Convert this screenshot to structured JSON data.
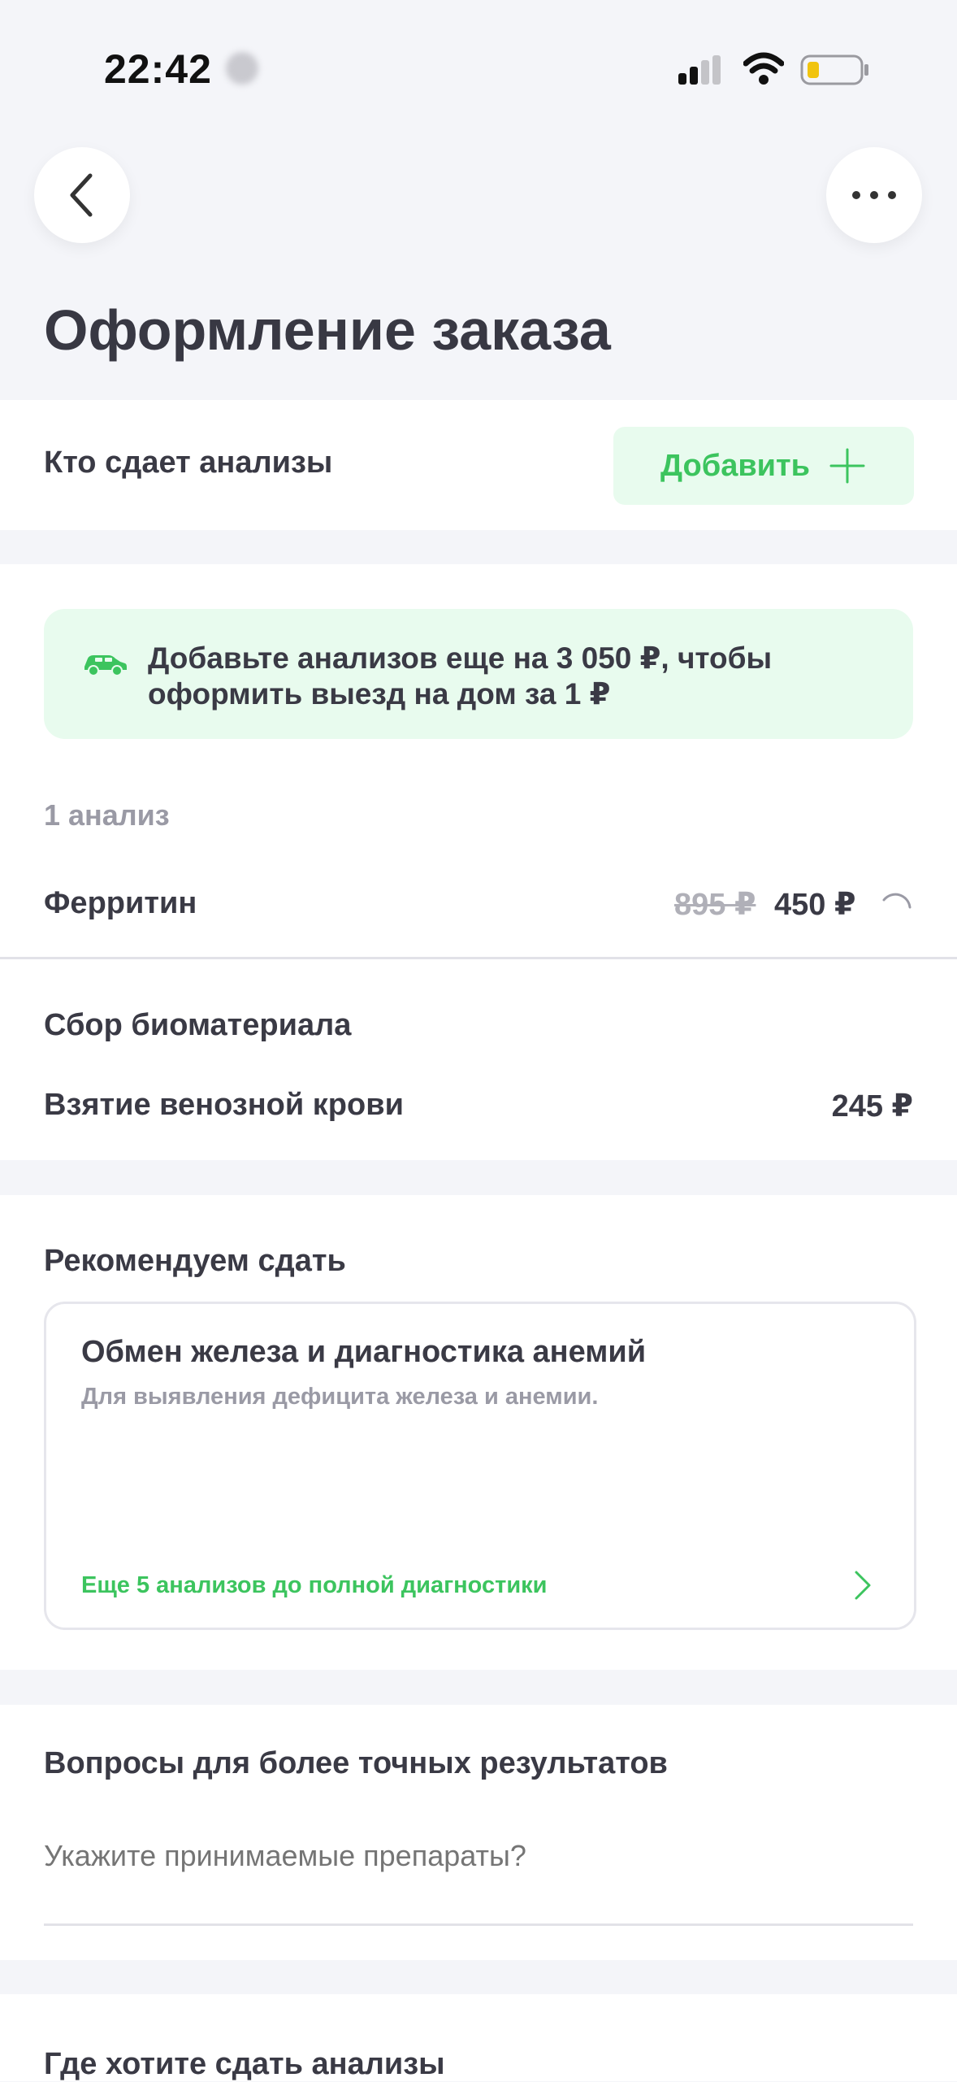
{
  "status_bar": {
    "time": "22:42"
  },
  "header": {
    "title": "Оформление заказа"
  },
  "who": {
    "label": "Кто сдает анализы",
    "add_label": "Добавить"
  },
  "promo": {
    "text": "Добавьте анализов еще на 3 050 ₽, чтобы оформить выезд на дом за 1 ₽"
  },
  "analyses": {
    "count_label": "1 анализ",
    "items": [
      {
        "name": "Ферритин",
        "old_price": "895 ₽",
        "price": "450 ₽"
      }
    ]
  },
  "biomaterial": {
    "title": "Сбор биоматериала",
    "item": "Взятие венозной крови",
    "price": "245 ₽"
  },
  "recommend": {
    "title": "Рекомендуем сдать",
    "card_title": "Обмен железа и диагностика анемий",
    "card_subtitle": "Для выявления дефицита железа и анемии.",
    "card_link": "Еще 5 анализов до полной диагностики"
  },
  "questions": {
    "title": "Вопросы для более точных результатов",
    "placeholder": "Укажите принимаемые препараты?"
  },
  "location": {
    "title": "Где хотите сдать анализы"
  },
  "colors": {
    "accent": "#3cc45e",
    "promo_bg": "#e8fbee",
    "background": "#f4f5f9"
  }
}
